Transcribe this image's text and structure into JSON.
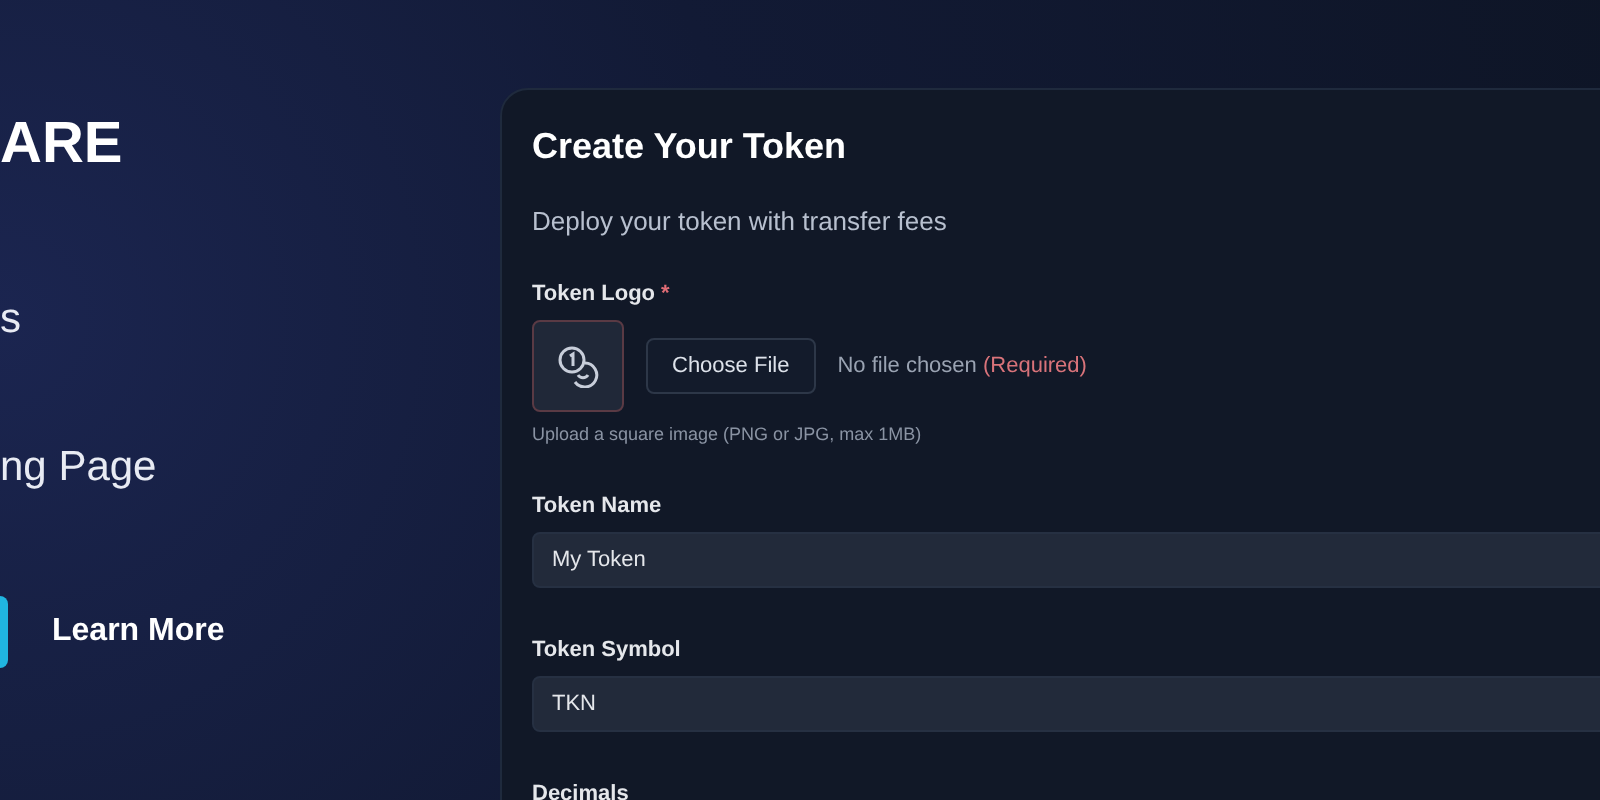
{
  "hero": {
    "title": "ARE",
    "links": [
      "s",
      "ng Page"
    ],
    "secondary_button": "Learn More"
  },
  "form": {
    "title": "Create Your Token",
    "subtitle": "Deploy your token with transfer fees",
    "logo": {
      "label": "Token Logo",
      "required_mark": "*",
      "button": "Choose File",
      "status": "No file chosen",
      "status_note": "(Required)",
      "hint": "Upload a square image (PNG or JPG, max 1MB)"
    },
    "fields": [
      {
        "label": "Token Name",
        "value": "My Token"
      },
      {
        "label": "Token Symbol",
        "value": "TKN"
      },
      {
        "label": "Decimals"
      }
    ]
  }
}
